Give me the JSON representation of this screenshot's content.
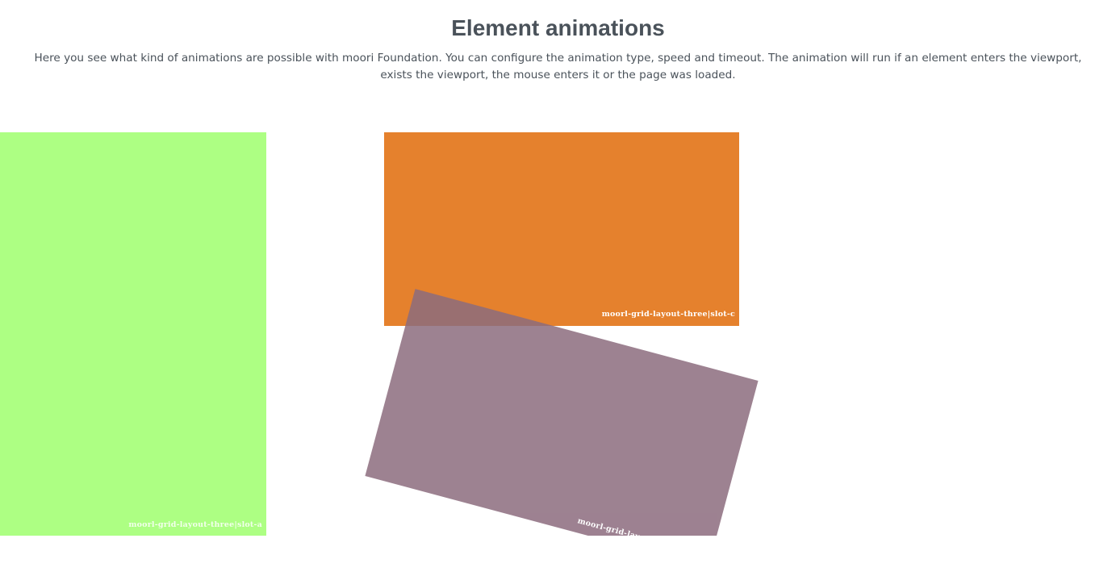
{
  "header": {
    "title": "Element animations",
    "intro": "Here you see what kind of animations are possible with moori Foundation. You can configure the animation type, speed and timeout. The animation will run if an element enters the viewport, exists the viewport, the mouse enters it or the page was loaded."
  },
  "slots": {
    "slot_a": {
      "label": "moorl-grid-layout-three|slot-a",
      "color": "#adff83"
    },
    "slot_c": {
      "label": "moorl-grid-layout-three|slot-c",
      "color": "#e5812d"
    },
    "slot_b": {
      "label": "moorl-grid-layout-three|slot-b",
      "color": "#8c6c7e"
    }
  }
}
